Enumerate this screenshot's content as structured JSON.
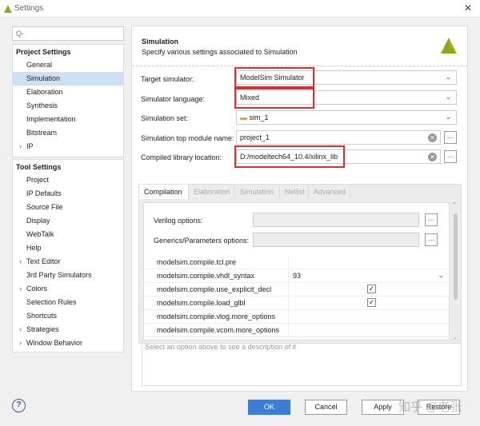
{
  "window": {
    "title": "Settings",
    "close": "✕"
  },
  "search": {
    "icon": "search-icon",
    "glyph": "Q-"
  },
  "project_settings": {
    "header": "Project Settings",
    "items": [
      {
        "label": "General"
      },
      {
        "label": "Simulation",
        "selected": true
      },
      {
        "label": "Elaboration"
      },
      {
        "label": "Synthesis"
      },
      {
        "label": "Implementation"
      },
      {
        "label": "Bitstream"
      },
      {
        "label": "IP",
        "expandable": true
      }
    ]
  },
  "tool_settings": {
    "header": "Tool Settings",
    "items": [
      {
        "label": "Project"
      },
      {
        "label": "IP Defaults"
      },
      {
        "label": "Source File"
      },
      {
        "label": "Display"
      },
      {
        "label": "WebTalk"
      },
      {
        "label": "Help"
      },
      {
        "label": "Text Editor",
        "expandable": true
      },
      {
        "label": "3rd Party Simulators"
      },
      {
        "label": "Colors",
        "expandable": true
      },
      {
        "label": "Selection Rules"
      },
      {
        "label": "Shortcuts"
      },
      {
        "label": "Strategies",
        "expandable": true
      },
      {
        "label": "Window Behavior",
        "expandable": true
      }
    ]
  },
  "panel": {
    "title": "Simulation",
    "subtitle": "Specify various settings associated to Simulation"
  },
  "form": {
    "target_simulator": {
      "label": "Target simulator:",
      "value": "ModelSim Simulator"
    },
    "simulator_language": {
      "label": "Simulator language:",
      "value": "Mixed"
    },
    "simulation_set": {
      "label": "Simulation set:",
      "value": "sim_1"
    },
    "top_module": {
      "label": "Simulation top module name:",
      "value": "project_1"
    },
    "compiled_lib": {
      "label": "Compiled library location:",
      "value": "D:/modeltech64_10.4/xilinx_lib"
    }
  },
  "tabs": [
    "Compilation",
    "Elaboration",
    "Simulation",
    "Netlist",
    "Advanced"
  ],
  "compilation": {
    "verilog_label": "Verilog options:",
    "generics_label": "Generics/Parameters options:",
    "rows": [
      {
        "key": "modelsim.compile.tcl.pre",
        "value": ""
      },
      {
        "key": "modelsim.compile.vhdl_syntax",
        "value": "93"
      },
      {
        "key": "modelsim.compile.use_explicit_decl",
        "checked": true
      },
      {
        "key": "modelsim.compile.load_glbl",
        "checked": true
      },
      {
        "key": "modelsim.compile.vlog.more_options",
        "value": ""
      },
      {
        "key": "modelsim.compile.vcom.more_options",
        "value": ""
      }
    ]
  },
  "description": "Select an option above to see a description of it",
  "buttons": {
    "help": "?",
    "ok": "OK",
    "cancel": "Cancel",
    "apply": "Apply",
    "restore": "Restore"
  },
  "watermark": "知乎 @老张",
  "colors": {
    "accent": "#3d7ed4",
    "highlight": "#d8302e",
    "selection": "#cfe0f5"
  }
}
